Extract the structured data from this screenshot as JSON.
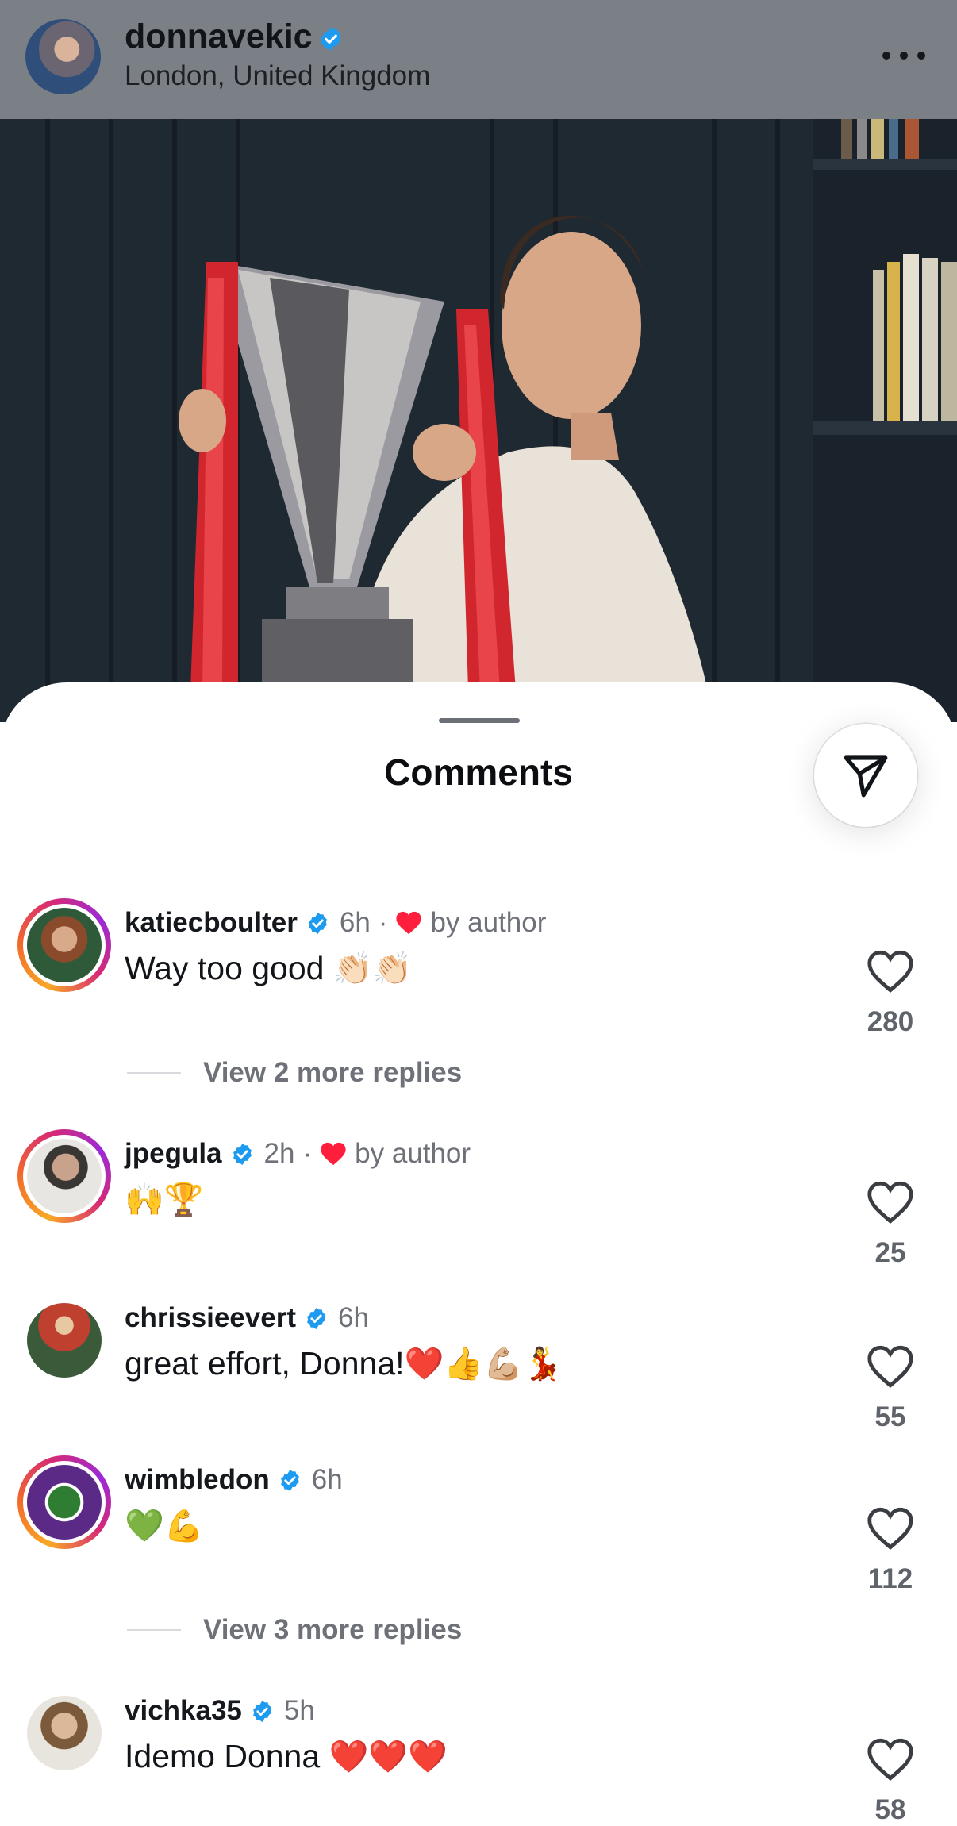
{
  "post": {
    "username": "donnavekic",
    "location": "London, United Kingdom"
  },
  "sheet": {
    "title": "Comments"
  },
  "icons": {
    "verified": "verified-badge-icon",
    "like": "heart-outline-icon",
    "share": "paper-plane-icon",
    "more": "more-options-icon",
    "liked_by_author": "red-heart-icon"
  },
  "colors": {
    "verified": "#1d9bf0",
    "liked_heart": "#ff1f3d",
    "secondary_text": "#6e7178"
  },
  "comments": [
    {
      "username": "katiecboulter",
      "time": "6h",
      "liked_by": "by author",
      "text": "Way too good",
      "emoji": "👏🏻👏🏻",
      "likes": "280",
      "replies": "View 2 more replies"
    },
    {
      "username": "jpegula",
      "time": "2h",
      "liked_by": "by author",
      "text": "",
      "emoji": "🙌🏆",
      "likes": "25"
    },
    {
      "username": "chrissieevert",
      "time": "6h",
      "text": "great effort, Donna!",
      "emoji": "❤️👍💪🏼💃",
      "likes": "55"
    },
    {
      "username": "wimbledon",
      "time": "6h",
      "text": "",
      "emoji": "💚💪",
      "likes": "112",
      "replies": "View 3 more replies"
    },
    {
      "username": "vichka35",
      "time": "5h",
      "text": "Idemo Donna",
      "emoji": "❤️❤️❤️",
      "likes": "58"
    }
  ]
}
